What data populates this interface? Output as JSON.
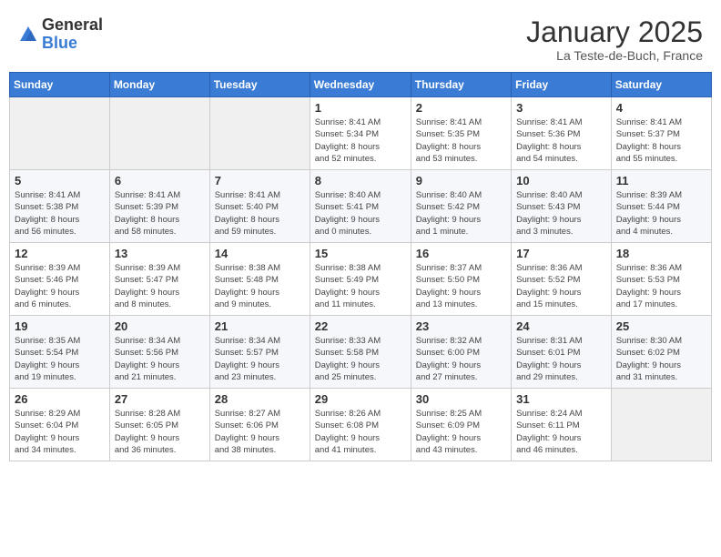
{
  "header": {
    "logo_general": "General",
    "logo_blue": "Blue",
    "month_title": "January 2025",
    "location": "La Teste-de-Buch, France"
  },
  "weekdays": [
    "Sunday",
    "Monday",
    "Tuesday",
    "Wednesday",
    "Thursday",
    "Friday",
    "Saturday"
  ],
  "weeks": [
    [
      {
        "day": "",
        "info": ""
      },
      {
        "day": "",
        "info": ""
      },
      {
        "day": "",
        "info": ""
      },
      {
        "day": "1",
        "info": "Sunrise: 8:41 AM\nSunset: 5:34 PM\nDaylight: 8 hours\nand 52 minutes."
      },
      {
        "day": "2",
        "info": "Sunrise: 8:41 AM\nSunset: 5:35 PM\nDaylight: 8 hours\nand 53 minutes."
      },
      {
        "day": "3",
        "info": "Sunrise: 8:41 AM\nSunset: 5:36 PM\nDaylight: 8 hours\nand 54 minutes."
      },
      {
        "day": "4",
        "info": "Sunrise: 8:41 AM\nSunset: 5:37 PM\nDaylight: 8 hours\nand 55 minutes."
      }
    ],
    [
      {
        "day": "5",
        "info": "Sunrise: 8:41 AM\nSunset: 5:38 PM\nDaylight: 8 hours\nand 56 minutes."
      },
      {
        "day": "6",
        "info": "Sunrise: 8:41 AM\nSunset: 5:39 PM\nDaylight: 8 hours\nand 58 minutes."
      },
      {
        "day": "7",
        "info": "Sunrise: 8:41 AM\nSunset: 5:40 PM\nDaylight: 8 hours\nand 59 minutes."
      },
      {
        "day": "8",
        "info": "Sunrise: 8:40 AM\nSunset: 5:41 PM\nDaylight: 9 hours\nand 0 minutes."
      },
      {
        "day": "9",
        "info": "Sunrise: 8:40 AM\nSunset: 5:42 PM\nDaylight: 9 hours\nand 1 minute."
      },
      {
        "day": "10",
        "info": "Sunrise: 8:40 AM\nSunset: 5:43 PM\nDaylight: 9 hours\nand 3 minutes."
      },
      {
        "day": "11",
        "info": "Sunrise: 8:39 AM\nSunset: 5:44 PM\nDaylight: 9 hours\nand 4 minutes."
      }
    ],
    [
      {
        "day": "12",
        "info": "Sunrise: 8:39 AM\nSunset: 5:46 PM\nDaylight: 9 hours\nand 6 minutes."
      },
      {
        "day": "13",
        "info": "Sunrise: 8:39 AM\nSunset: 5:47 PM\nDaylight: 9 hours\nand 8 minutes."
      },
      {
        "day": "14",
        "info": "Sunrise: 8:38 AM\nSunset: 5:48 PM\nDaylight: 9 hours\nand 9 minutes."
      },
      {
        "day": "15",
        "info": "Sunrise: 8:38 AM\nSunset: 5:49 PM\nDaylight: 9 hours\nand 11 minutes."
      },
      {
        "day": "16",
        "info": "Sunrise: 8:37 AM\nSunset: 5:50 PM\nDaylight: 9 hours\nand 13 minutes."
      },
      {
        "day": "17",
        "info": "Sunrise: 8:36 AM\nSunset: 5:52 PM\nDaylight: 9 hours\nand 15 minutes."
      },
      {
        "day": "18",
        "info": "Sunrise: 8:36 AM\nSunset: 5:53 PM\nDaylight: 9 hours\nand 17 minutes."
      }
    ],
    [
      {
        "day": "19",
        "info": "Sunrise: 8:35 AM\nSunset: 5:54 PM\nDaylight: 9 hours\nand 19 minutes."
      },
      {
        "day": "20",
        "info": "Sunrise: 8:34 AM\nSunset: 5:56 PM\nDaylight: 9 hours\nand 21 minutes."
      },
      {
        "day": "21",
        "info": "Sunrise: 8:34 AM\nSunset: 5:57 PM\nDaylight: 9 hours\nand 23 minutes."
      },
      {
        "day": "22",
        "info": "Sunrise: 8:33 AM\nSunset: 5:58 PM\nDaylight: 9 hours\nand 25 minutes."
      },
      {
        "day": "23",
        "info": "Sunrise: 8:32 AM\nSunset: 6:00 PM\nDaylight: 9 hours\nand 27 minutes."
      },
      {
        "day": "24",
        "info": "Sunrise: 8:31 AM\nSunset: 6:01 PM\nDaylight: 9 hours\nand 29 minutes."
      },
      {
        "day": "25",
        "info": "Sunrise: 8:30 AM\nSunset: 6:02 PM\nDaylight: 9 hours\nand 31 minutes."
      }
    ],
    [
      {
        "day": "26",
        "info": "Sunrise: 8:29 AM\nSunset: 6:04 PM\nDaylight: 9 hours\nand 34 minutes."
      },
      {
        "day": "27",
        "info": "Sunrise: 8:28 AM\nSunset: 6:05 PM\nDaylight: 9 hours\nand 36 minutes."
      },
      {
        "day": "28",
        "info": "Sunrise: 8:27 AM\nSunset: 6:06 PM\nDaylight: 9 hours\nand 38 minutes."
      },
      {
        "day": "29",
        "info": "Sunrise: 8:26 AM\nSunset: 6:08 PM\nDaylight: 9 hours\nand 41 minutes."
      },
      {
        "day": "30",
        "info": "Sunrise: 8:25 AM\nSunset: 6:09 PM\nDaylight: 9 hours\nand 43 minutes."
      },
      {
        "day": "31",
        "info": "Sunrise: 8:24 AM\nSunset: 6:11 PM\nDaylight: 9 hours\nand 46 minutes."
      },
      {
        "day": "",
        "info": ""
      }
    ]
  ]
}
